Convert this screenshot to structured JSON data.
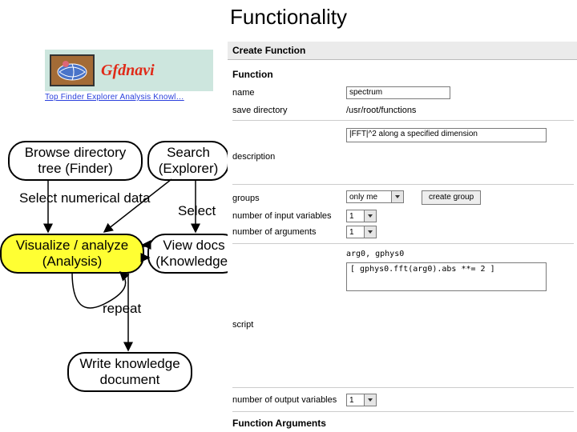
{
  "title": "Functionality",
  "logo": {
    "text": "Gfdnavi"
  },
  "nav": "Top Finder Explorer Analysis Knowl…",
  "nodes": {
    "browse": {
      "l1": "Browse directory",
      "l2": "tree (Finder)"
    },
    "search": {
      "l1": "Search",
      "l2": "(Explorer)"
    },
    "visualize": {
      "l1": "Visualize / analyze",
      "l2": "(Analysis)"
    },
    "view": {
      "l1": "View docs",
      "l2": "(Knowledge)"
    },
    "write": {
      "l1": "Write knowledge",
      "l2": "document"
    }
  },
  "labels": {
    "selectData": "Select numerical data",
    "select": "Select",
    "repeat": "repeat"
  },
  "panel": {
    "winTitle": "Create Function",
    "functionHeader": "Function",
    "nameLabel": "name",
    "nameValue": "spectrum",
    "saveDirLabel": "save directory",
    "saveDirValue": "/usr/root/functions",
    "descLabel": "description",
    "descValue": "|FFT|^2 along a specified dimension",
    "groupsLabel": "groups",
    "groupsValue": "only me",
    "createGroupBtn": "create group",
    "numInputLabel": "number of input variables",
    "numInputValue": "1",
    "numArgsLabel": "number of arguments",
    "numArgsValue": "1",
    "argHint": "arg0, gphys0",
    "script": "[ gphys0.fft(arg0).abs **= 2 ]",
    "scriptLabel": "script",
    "numOutLabel": "number of output variables",
    "numOutValue": "1",
    "funcArgsHeader": "Function Arguments"
  }
}
